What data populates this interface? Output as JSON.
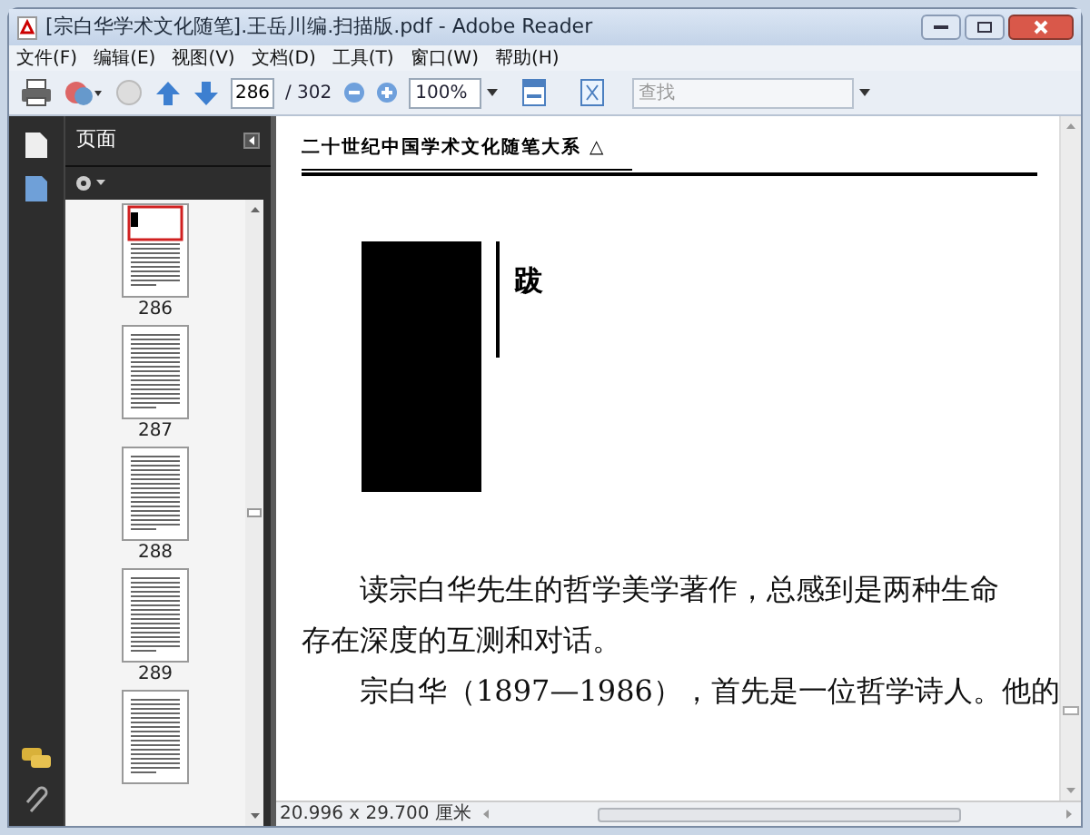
{
  "window": {
    "title": "[宗白华学术文化随笔].王岳川编.扫描版.pdf - Adobe Reader"
  },
  "menu": [
    "文件(F)",
    "编辑(E)",
    "视图(V)",
    "文档(D)",
    "工具(T)",
    "窗口(W)",
    "帮助(H)"
  ],
  "toolbar": {
    "page": "286",
    "page_total": "/ 302",
    "zoom": "100%",
    "search_placeholder": "查找"
  },
  "panel": {
    "title": "页面",
    "thumbnails": [
      {
        "label": "286",
        "selected": true
      },
      {
        "label": "287",
        "selected": false
      },
      {
        "label": "288",
        "selected": false
      },
      {
        "label": "289",
        "selected": false
      },
      {
        "selected": false
      }
    ]
  },
  "document": {
    "running_head": "二十世纪中国学术文化随笔大系 △",
    "heading": "跋",
    "paragraphs": [
      "读宗白华先生的哲学美学著作，总感到是两种生命存在深度的互测和对话。",
      "宗白华（1897—1986），首先是一位哲学诗人。他的"
    ]
  },
  "status_bar": {
    "page_size": "20.996 x 29.700 厘米"
  }
}
